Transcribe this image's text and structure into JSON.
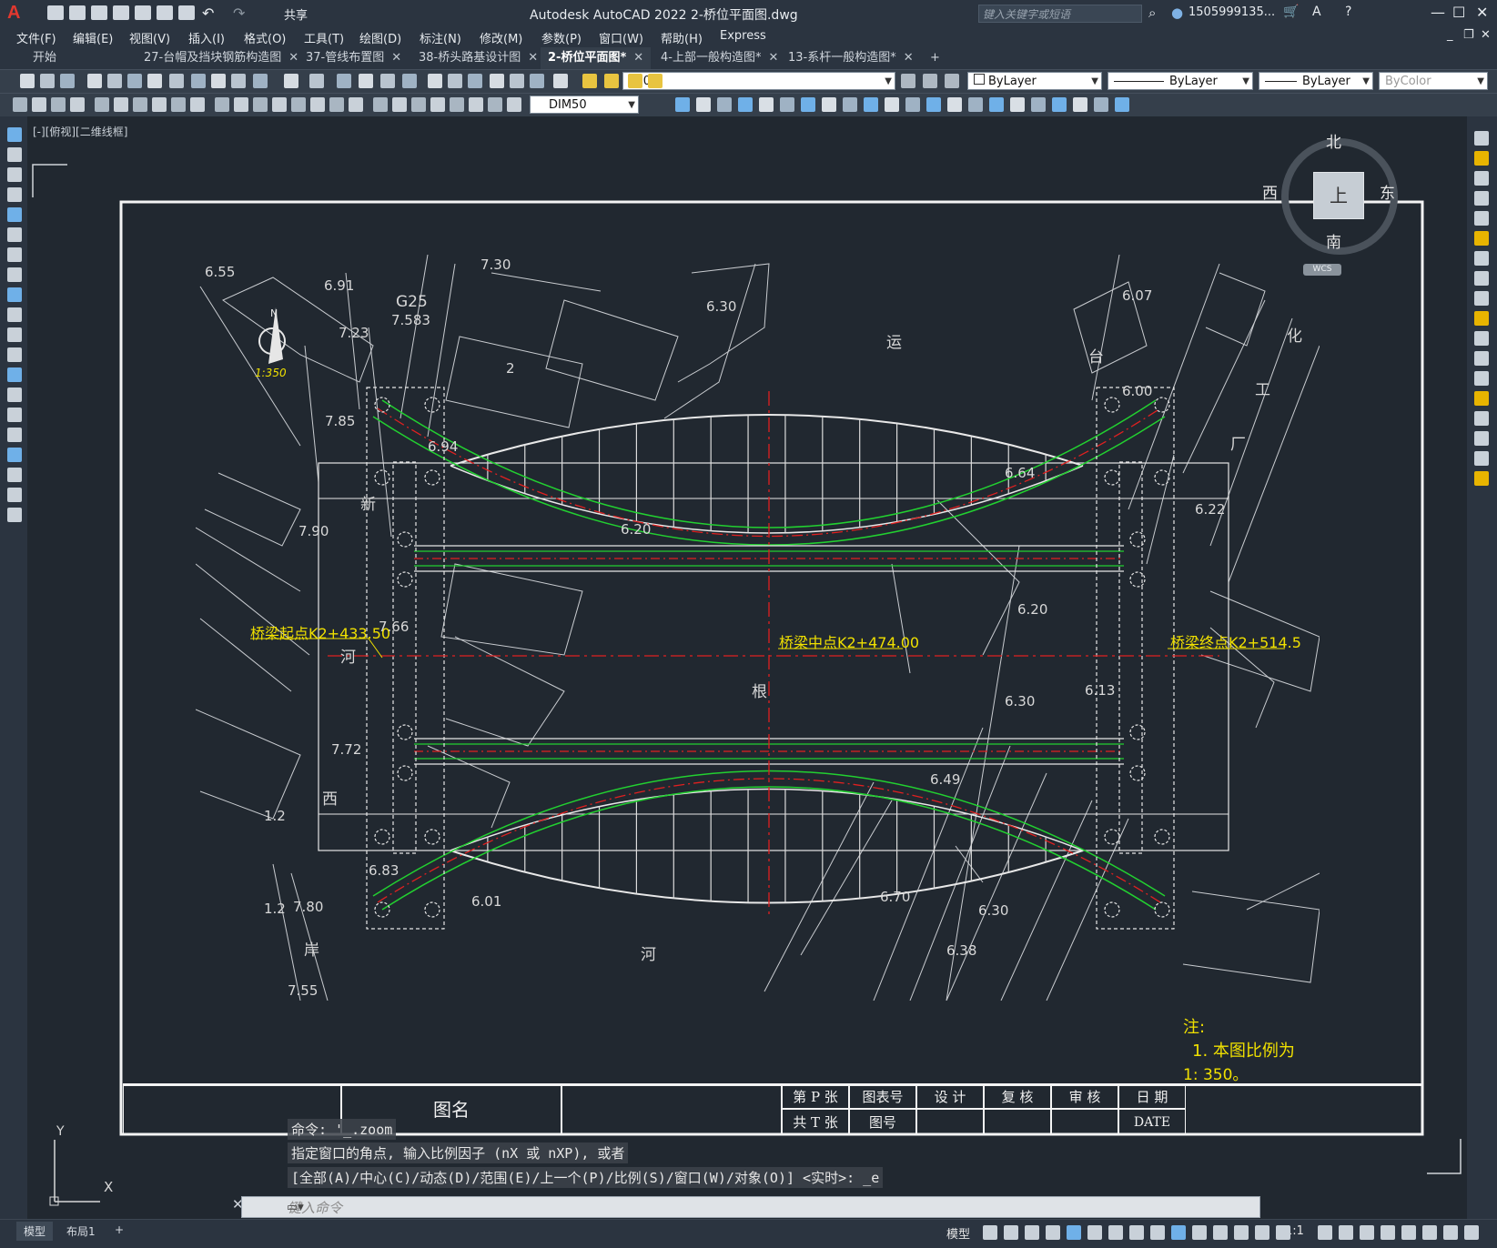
{
  "window": {
    "title": "Autodesk AutoCAD 2022    2-桥位平面图.dwg",
    "share_label": "共享",
    "search_placeholder": "键入关键字或短语",
    "user_name": "1505999135...",
    "app_letter": "A"
  },
  "menu": [
    "文件(F)",
    "编辑(E)",
    "视图(V)",
    "插入(I)",
    "格式(O)",
    "工具(T)",
    "绘图(D)",
    "标注(N)",
    "修改(M)",
    "参数(P)",
    "窗口(W)",
    "帮助(H)",
    "Express"
  ],
  "tabs": [
    {
      "label": "开始",
      "close": ""
    },
    {
      "label": "27-台帽及挡块钢筋构造图",
      "close": "✕"
    },
    {
      "label": "37-管线布置图",
      "close": "✕"
    },
    {
      "label": "38-桥头路基设计图",
      "close": "✕"
    },
    {
      "label": "2-桥位平面图*",
      "close": "✕"
    },
    {
      "label": "4-上部一般构造图*",
      "close": "✕"
    },
    {
      "label": "13-系杆一般构造图*",
      "close": "✕"
    },
    {
      "label": "+",
      "close": ""
    }
  ],
  "toolbar": {
    "layer": "0",
    "color": "ByLayer",
    "linetype": "ByLayer",
    "lineweight": "ByLayer",
    "plotstyle": "ByColor",
    "dimstyle": "DIM50"
  },
  "canvas": {
    "view_label": "[-][俯视][二维线框]"
  },
  "viewcube": {
    "north": "北",
    "south": "南",
    "east": "东",
    "west": "西",
    "top": "上",
    "wcs": "WCS"
  },
  "drawing": {
    "start_label": "桥梁起点K2+433.50",
    "mid_label": "桥梁中点K2+474.00",
    "end_label": "桥梁终点K2+514.5",
    "scale_label": "1:350",
    "north_letter": "N",
    "note_title": "注:",
    "note_line1": "1. 本图比例为",
    "note_line2": "1: 350。",
    "g25": "G25",
    "elevations": [
      "6.55",
      "6.91",
      "7.583",
      "7.30",
      "7.23",
      "6.30",
      "7.85",
      "6.94",
      "6.20",
      "7.90",
      "7.66",
      "7.72",
      "6.83",
      "6.01",
      "1.2",
      "1.2",
      "7.80",
      "7.55",
      "6.07",
      "6.00",
      "6.64",
      "6.22",
      "6.20",
      "6.30",
      "6.13",
      "6.49",
      "6.70",
      "6.30",
      "6.38",
      "2"
    ],
    "chars": [
      "运",
      "化",
      "工",
      "厂",
      "新",
      "河",
      "根",
      "西",
      "岸",
      "河",
      "台"
    ],
    "title_block": {
      "drawing_name": "图名",
      "sheet_p": "第 P 张",
      "sheet_t": "共 T 张",
      "table_no": "图表号",
      "drawing_no": "图号",
      "design": "设 计",
      "review": "复 核",
      "approve": "审 核",
      "date": "日 期",
      "date_value": "DATE"
    }
  },
  "command": {
    "history1": "命令: '_.zoom",
    "history2": "指定窗口的角点, 输入比例因子 (nX 或 nXP), 或者",
    "history3": "[全部(A)/中心(C)/动态(D)/范围(E)/上一个(P)/比例(S)/窗口(W)/对象(O)] <实时>: _e",
    "input_placeholder": "键入命令"
  },
  "ucs": {
    "y": "Y",
    "x": "X"
  },
  "status": {
    "layout_tabs": [
      "模型",
      "布局1",
      "+"
    ],
    "model_label": "模型",
    "scale": "1:1"
  }
}
